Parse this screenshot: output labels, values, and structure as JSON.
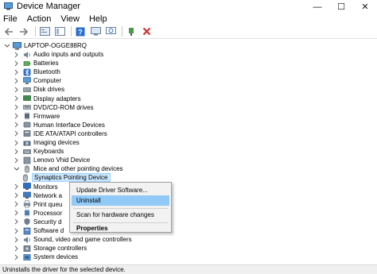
{
  "window": {
    "title": "Device Manager",
    "minimize_glyph": "—",
    "maximize_glyph": "☐",
    "close_glyph": "✕"
  },
  "menu": [
    "File",
    "Action",
    "View",
    "Help"
  ],
  "toolbar": {
    "icons": [
      "back-icon",
      "forward-icon",
      "properties-icon",
      "show-hide-icon",
      "help-icon",
      "update-driver-icon",
      "scan-hardware-icon",
      "add-legacy-icon",
      "uninstall-icon"
    ]
  },
  "tree": {
    "root": "LAPTOP-OGGE88RQ",
    "categories": [
      {
        "label": "Audio inputs and outputs",
        "icon": "speaker-icon"
      },
      {
        "label": "Batteries",
        "icon": "battery-icon"
      },
      {
        "label": "Bluetooth",
        "icon": "bluetooth-icon"
      },
      {
        "label": "Computer",
        "icon": "computer-icon"
      },
      {
        "label": "Disk drives",
        "icon": "disk-icon"
      },
      {
        "label": "Display adapters",
        "icon": "display-icon"
      },
      {
        "label": "DVD/CD-ROM drives",
        "icon": "dvd-icon"
      },
      {
        "label": "Firmware",
        "icon": "chip-icon"
      },
      {
        "label": "Human Interface Devices",
        "icon": "hid-icon"
      },
      {
        "label": "IDE ATA/ATAPI controllers",
        "icon": "controller-icon"
      },
      {
        "label": "Imaging devices",
        "icon": "camera-icon"
      },
      {
        "label": "Keyboards",
        "icon": "keyboard-icon"
      },
      {
        "label": "Lenovo Vhid Device",
        "icon": "device-icon"
      },
      {
        "label": "Mice and other pointing devices",
        "icon": "mouse-icon",
        "expanded": true
      },
      {
        "label": "Synaptics Pointing Device",
        "icon": "mouse-icon",
        "child": true,
        "selected": true
      },
      {
        "label": "Monitors",
        "icon": "monitor-icon"
      },
      {
        "label": "Network a",
        "icon": "network-icon"
      },
      {
        "label": "Print queu",
        "icon": "printer-icon"
      },
      {
        "label": "Processor",
        "icon": "processor-icon"
      },
      {
        "label": "Security d",
        "icon": "security-icon"
      },
      {
        "label": "Software d",
        "icon": "software-icon"
      },
      {
        "label": "Sound, video and game controllers",
        "icon": "speaker-icon"
      },
      {
        "label": "Storage controllers",
        "icon": "storage-icon"
      },
      {
        "label": "System devices",
        "icon": "system-icon"
      }
    ]
  },
  "context_menu": {
    "items": [
      "Update Driver Software...",
      "Uninstall",
      "Scan for hardware changes",
      "Properties"
    ],
    "highlighted": "Uninstall"
  },
  "status": "Uninstalls the driver for the selected device.",
  "colors": {
    "selection": "#cce8ff",
    "menu_highlight": "#91c9f7",
    "uninstall_red": "#d32f2f",
    "icon_blue": "#2a6fc9"
  }
}
